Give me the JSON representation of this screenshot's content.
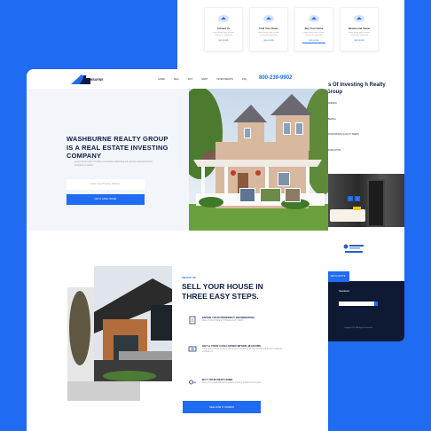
{
  "back_page": {
    "steps": [
      {
        "icon": "house-icon",
        "title": "Contact Us",
        "desc": "Lorem ipsum dolor sit amet, consectetur adipiscing",
        "button": "SEE MORE"
      },
      {
        "icon": "house-icon",
        "title": "Find Your Home",
        "desc": "Lorem ipsum dolor sit amet, consectetur adipiscing",
        "button": "SEE MORE"
      },
      {
        "icon": "house-icon",
        "title": "Buy Your Home",
        "desc": "Lorem ipsum dolor sit amet, consectetur adipiscing",
        "button": "SEE MORE"
      },
      {
        "icon": "house-icon",
        "title": "Review and Invest",
        "desc": "Lorem ipsum dolor sit amet, consectetur adipiscing",
        "button": "SEE MORE"
      }
    ],
    "why": {
      "title": "ts Of Investing h Realty Group",
      "text": "Lorem ipsum dolor sit amet consectetur adipiscing elit",
      "items": [
        "PERIENCE",
        "MBERING",
        "PROFESSIONAL QUALITY DEEDS",
        "MMUNICATION"
      ]
    },
    "footer": {
      "get_button": "GET A QUOTE",
      "newsletter_label": "Newsletter",
      "copyright": "Copyright 2021 All Rights Reserved"
    }
  },
  "nav": {
    "logo_text": "WASHBURNE",
    "links": [
      "HOME",
      "SELL",
      "BUY",
      "RENT",
      "INVESTMENTS",
      "FAQ"
    ],
    "phone": "800-239-9902"
  },
  "hero": {
    "title": "WASHBURNE REALTY GROUP IS A REAL ESTATE INVESTING COMPANY",
    "subtitle": "Lorem ipsum dolor sit amet, consectetur adipiscing elit, sed do eiusmod tempor incididunt ut labore.",
    "input_placeholder": "Enter Your Property Address",
    "button": "GET A CASH OFFER"
  },
  "about": {
    "label": "ABOUT US",
    "title": "SELL YOUR HOUSE IN THREE EASY STEPS.",
    "features": [
      {
        "icon": "document-icon",
        "title": "ENTER YOUR PROPERTY INFORMATION",
        "desc": "SELL YOUR HOME IN THREE EASY STEPS"
      },
      {
        "icon": "cash-icon",
        "title": "GET A YOUR CASH OFFER WITHIN 48 HOURS",
        "desc": "Lorem ipsum dolor sit amet, consectetur adipiscing elit sed do eiusmod tempor incididunt ut labore et."
      },
      {
        "icon": "key-icon",
        "title": "BUY YOUR NEXT HOME",
        "desc": "Enter your email address to receive property details in your inbox."
      }
    ],
    "button": "SEE HOW IT WORKS"
  },
  "colors": {
    "accent": "#1f6bf2",
    "navy": "#0d1d45",
    "background": "#1f6bf2"
  }
}
